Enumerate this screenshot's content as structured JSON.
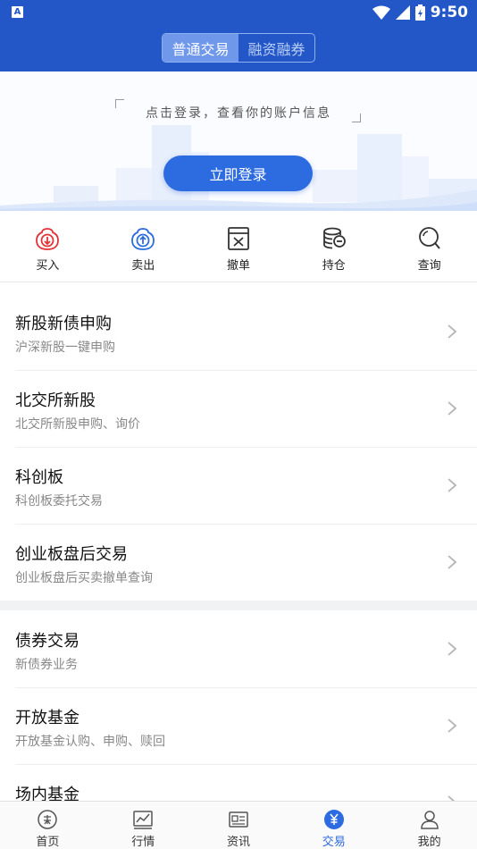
{
  "status_bar": {
    "time": "9:50",
    "notification_badge": "A"
  },
  "header": {
    "tabs": [
      {
        "label": "普通交易",
        "active": true
      },
      {
        "label": "融资融券",
        "active": false
      }
    ]
  },
  "banner": {
    "prompt": "点击登录，查看你的账户信息",
    "login_label": "立即登录"
  },
  "actions": [
    {
      "label": "买入",
      "icon": "buy-icon",
      "color": "#e0343a"
    },
    {
      "label": "卖出",
      "icon": "sell-icon",
      "color": "#2d6be0"
    },
    {
      "label": "撤单",
      "icon": "cancel-order-icon",
      "color": "#333333"
    },
    {
      "label": "持仓",
      "icon": "holdings-icon",
      "color": "#333333"
    },
    {
      "label": "查询",
      "icon": "query-icon",
      "color": "#333333"
    }
  ],
  "list_group_1": [
    {
      "title": "新股新债申购",
      "subtitle": "沪深新股一键申购"
    },
    {
      "title": "北交所新股",
      "subtitle": "北交所新股申购、询价"
    },
    {
      "title": "科创板",
      "subtitle": "科创板委托交易"
    },
    {
      "title": "创业板盘后交易",
      "subtitle": "创业板盘后买卖撤单查询"
    }
  ],
  "list_group_2": [
    {
      "title": "债券交易",
      "subtitle": "新债券业务"
    },
    {
      "title": "开放基金",
      "subtitle": "开放基金认购、申购、赎回"
    },
    {
      "title": "场内基金",
      "subtitle": ""
    }
  ],
  "bottom_nav": [
    {
      "label": "首页",
      "icon": "home-icon",
      "active": false
    },
    {
      "label": "行情",
      "icon": "market-icon",
      "active": false
    },
    {
      "label": "资讯",
      "icon": "news-icon",
      "active": false
    },
    {
      "label": "交易",
      "icon": "trade-icon",
      "active": true
    },
    {
      "label": "我的",
      "icon": "profile-icon",
      "active": false
    }
  ],
  "colors": {
    "brand": "#2357c7",
    "accent": "#2d6be0",
    "buy": "#e0343a"
  }
}
